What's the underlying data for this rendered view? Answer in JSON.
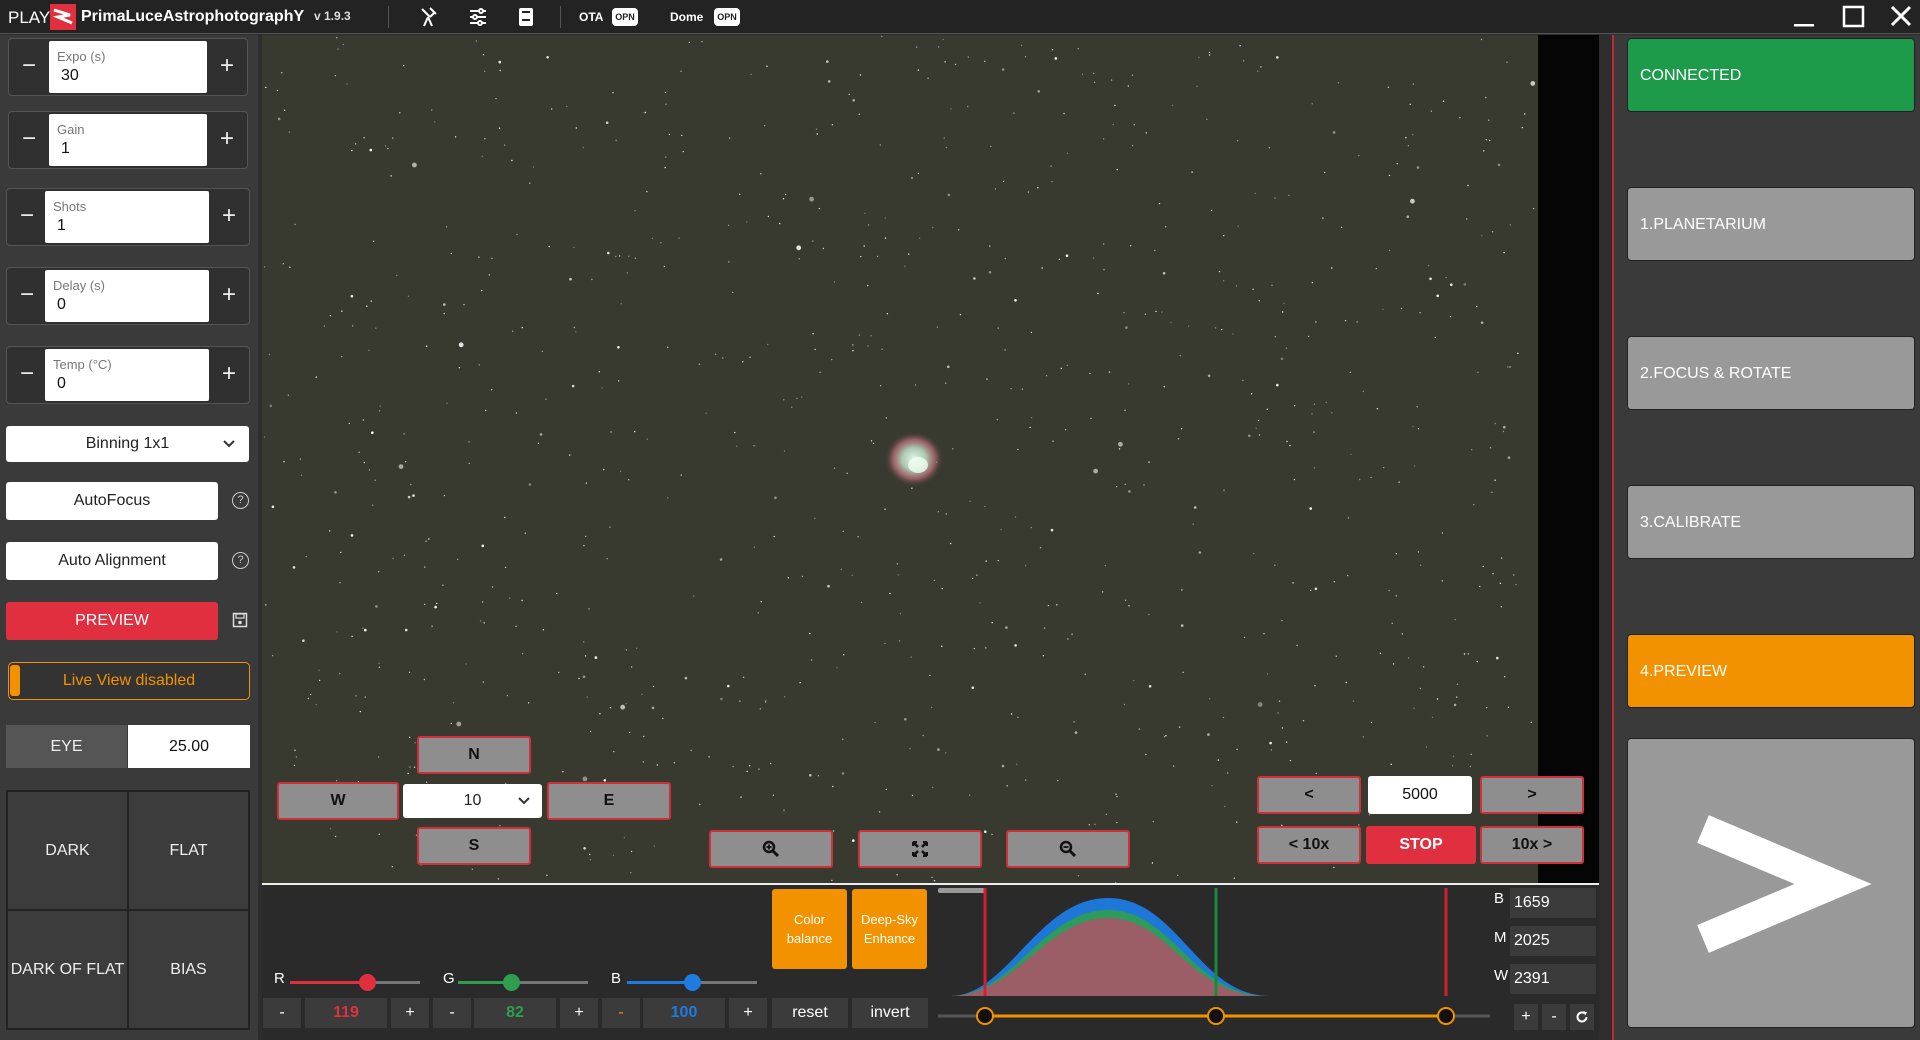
{
  "titlebar": {
    "play": "PLAY",
    "brand": "PrimaLuceAstrophotographY",
    "version": "v 1.9.3",
    "ota_label": "OTA",
    "ota_status": "OPN",
    "dome_label": "Dome",
    "dome_status": "OPN"
  },
  "capture": {
    "expo": {
      "label": "Expo (s)",
      "value": "30"
    },
    "gain": {
      "label": "Gain",
      "value": "1"
    },
    "shots": {
      "label": "Shots",
      "value": "1"
    },
    "delay": {
      "label": "Delay (s)",
      "value": "0"
    },
    "temp": {
      "label": "Temp (°C)",
      "value": "0"
    },
    "minus": "−",
    "plus": "+",
    "binning": "Binning 1x1",
    "autofocus": "AutoFocus",
    "auto_alignment": "Auto Alignment",
    "help": "?",
    "preview": "PREVIEW",
    "live_view": "Live View disabled",
    "eye_label": "EYE",
    "eye_value": "25.00",
    "calibration": [
      "DARK",
      "FLAT",
      "DARK OF FLAT",
      "BIAS"
    ]
  },
  "guide": {
    "north": "N",
    "south": "S",
    "west": "W",
    "east": "E",
    "step": "10"
  },
  "frames": {
    "prev": "<",
    "next": ">",
    "prev10": "< 10x",
    "next10": "10x >",
    "value": "5000",
    "stop": "STOP"
  },
  "color": {
    "r_label": "R",
    "r_value": "119",
    "r_level": 0.59,
    "g_label": "G",
    "g_value": "82",
    "g_level": 0.41,
    "b_label": "B",
    "b_value": "100",
    "b_level": 0.5,
    "minus": "-",
    "plus": "+",
    "color_balance": [
      "Color",
      "balance"
    ],
    "deep_sky": [
      "Deep-Sky",
      "Enhance"
    ],
    "reset": "reset",
    "invert": "invert",
    "red": "#e0303f",
    "green": "#2e9e4f",
    "blue": "#1e7be0"
  },
  "histogram": {
    "b_label": "B",
    "b_value": "1659",
    "m_label": "M",
    "m_value": "2025",
    "w_label": "W",
    "w_value": "2391",
    "plus": "+",
    "minus": "-"
  },
  "steps": {
    "connected": "CONNECTED",
    "planetarium": "1.PLANETARIUM",
    "focus": "2.FOCUS & ROTATE",
    "calibrate": "3.CALIBRATE",
    "preview": "4.PREVIEW",
    "accent": "#f39200",
    "connected_color": "#1e9a4b"
  }
}
